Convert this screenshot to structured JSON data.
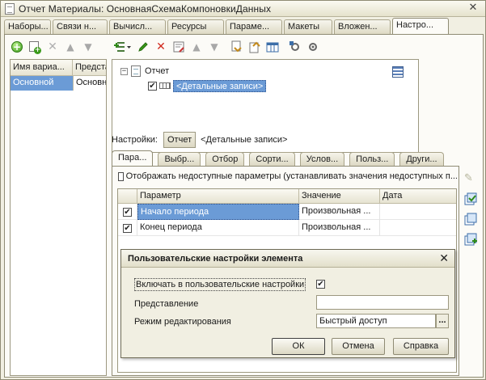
{
  "window": {
    "title": "Отчет Материалы: ОсновнаяСхемаКомпоновкиДанных",
    "close_glyph": "✕"
  },
  "top_tabs": [
    {
      "label": "Наборы..."
    },
    {
      "label": "Связи н..."
    },
    {
      "label": "Вычисл..."
    },
    {
      "label": "Ресурсы"
    },
    {
      "label": "Параме..."
    },
    {
      "label": "Макеты"
    },
    {
      "label": "Вложен..."
    },
    {
      "label": "Настро..."
    }
  ],
  "variants": {
    "headers": [
      "Имя вариа...",
      "Предста"
    ],
    "rows": [
      {
        "name": "Основной",
        "presentation": "Основн"
      }
    ]
  },
  "structure": {
    "root_label": "Отчет",
    "root_expander": "−",
    "child_label": "<Детальные записи>",
    "child_checked": "✔"
  },
  "settings": {
    "label": "Настройки:",
    "report_button": "Отчет",
    "current": "<Детальные записи>"
  },
  "inner_tabs": [
    {
      "label": "Пара..."
    },
    {
      "label": "Выбр..."
    },
    {
      "label": "Отбор"
    },
    {
      "label": "Сорти..."
    },
    {
      "label": "Услов..."
    },
    {
      "label": "Польз..."
    },
    {
      "label": "Други..."
    }
  ],
  "params": {
    "show_unavailable_label": "Отображать недоступные параметры (устанавливать значения недоступных п...",
    "headers": [
      "Параметр",
      "Значение",
      "Дата"
    ],
    "rows": [
      {
        "checked": "✔",
        "name": "Начало периода",
        "value": "Произвольная ...",
        "date": ""
      },
      {
        "checked": "✔",
        "name": "Конец периода",
        "value": "Произвольная ...",
        "date": ""
      }
    ]
  },
  "dialog": {
    "title": "Пользовательские настройки элемента",
    "close_glyph": "✕",
    "include_label": "Включать в пользовательские настройки",
    "include_checked": "✔",
    "presentation_label": "Представление",
    "presentation_value": "",
    "edit_mode_label": "Режим редактирования",
    "edit_mode_value": "Быстрый доступ",
    "dots": "...",
    "ok": "ОК",
    "cancel": "Отмена",
    "help": "Справка"
  },
  "icons": {
    "add": "add-icon",
    "copy": "copy-icon",
    "delete": "delete-icon",
    "move_up": "arrow-up-icon",
    "move_down": "arrow-down-icon",
    "edit": "pencil-icon"
  }
}
